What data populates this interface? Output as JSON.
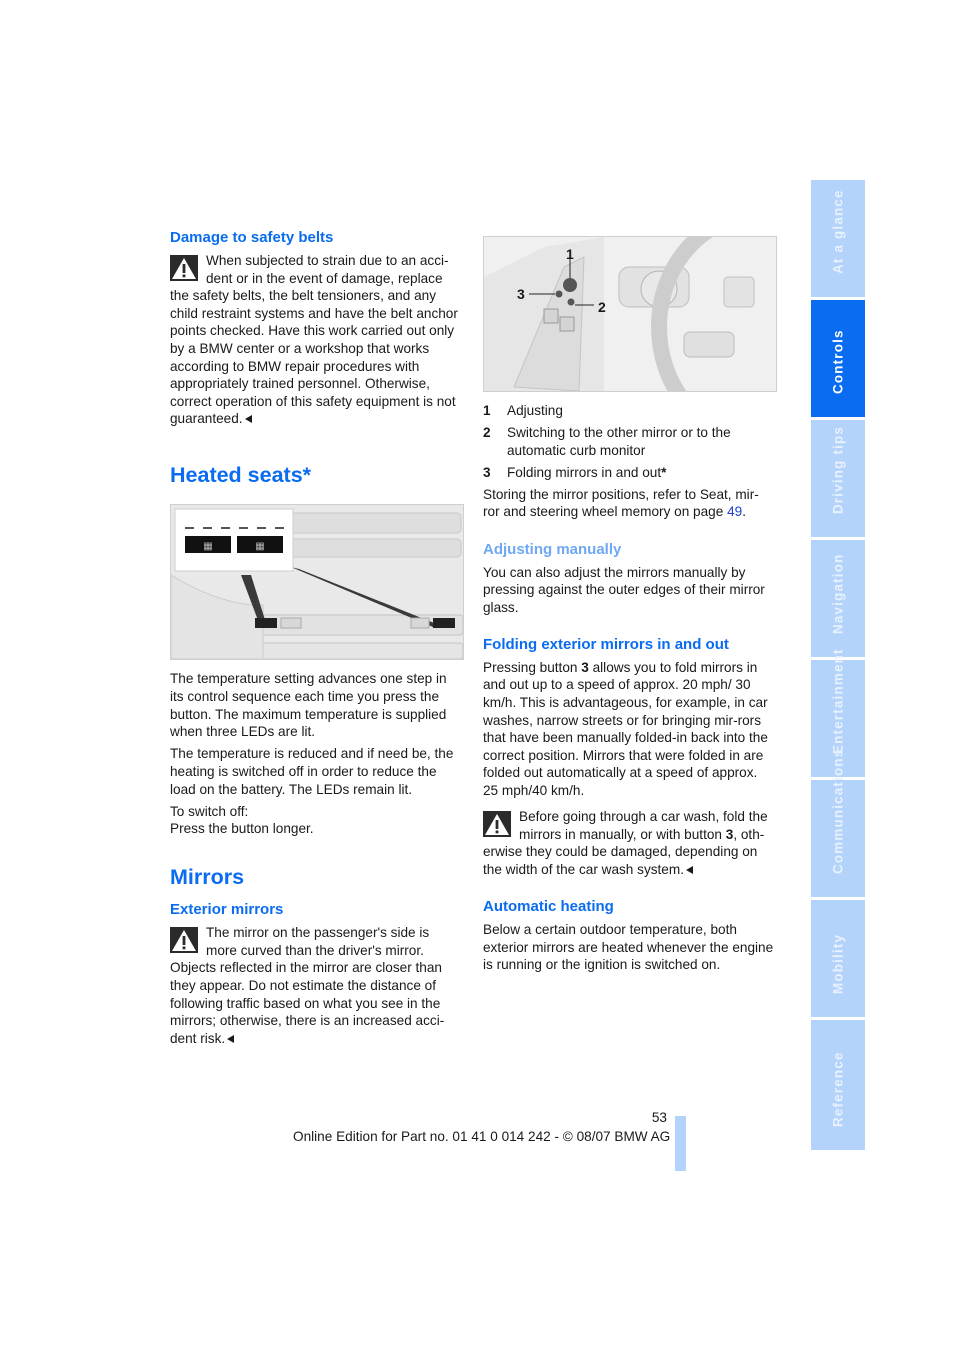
{
  "left_column": {
    "damage_heading": "Damage to safety belts",
    "damage_warning": "When subjected to strain due to an acci-dent or in the event of damage, replace the safety belts, the belt tensioners, and any child restraint systems and have the belt anchor points checked. Have this work carried out only by a BMW center or a workshop that works according to BMW repair procedures with appropriately trained personnel. Otherwise, correct operation of this safety equipment is not guaranteed.",
    "heated_seats_title": "Heated seats*",
    "heated_para1": "The temperature setting advances one step in its control sequence each time you press the button. The maximum temperature is supplied when three LEDs are lit.",
    "heated_para2": "The temperature is reduced and if need be, the heating is switched off in order to reduce the load on the battery. The LEDs remain lit.",
    "switch_off_label": "To switch off:",
    "switch_off_text": "Press the button longer.",
    "mirrors_title": "Mirrors",
    "exterior_heading": "Exterior mirrors",
    "exterior_warning": "The mirror on the passenger's side is more curved than the driver's mirror. Objects reflected in the mirror are closer than they appear. Do not estimate the distance of following traffic based on what you see in the mirrors; otherwise, there is an increased acci-dent risk."
  },
  "right_column": {
    "figure_callouts": [
      "1",
      "2",
      "3"
    ],
    "legend": [
      {
        "num": "1",
        "text": "Adjusting"
      },
      {
        "num": "2",
        "text": "Switching to the other mirror or to the automatic curb monitor"
      },
      {
        "num": "3",
        "text": "Folding mirrors in and out",
        "asterisk": "*"
      }
    ],
    "storing_text": "Storing the mirror positions, refer to Seat, mir-ror and steering wheel memory on page ",
    "storing_page_link": "49",
    "storing_end": ".",
    "adjusting_heading": "Adjusting manually",
    "adjusting_text": "You can also adjust the mirrors manually by pressing against the outer edges of their mirror glass.",
    "folding_heading": "Folding exterior mirrors in and out",
    "folding_text_pre": "Pressing button ",
    "folding_button": "3",
    "folding_text_post": " allows you to fold mirrors in and out up to a speed of approx. 20 mph/ 30 km/h. This is advantageous, for example, in car washes, narrow streets or for bringing mir-rors that have been manually folded-in back into the correct position. Mirrors that were folded in are folded out automatically at a speed of approx. 25 mph/40 km/h.",
    "carwash_warning_pre": "Before going through a car wash, fold the mirrors in manually, or with button ",
    "carwash_button": "3",
    "carwash_warning_post": ", oth-erwise they could be damaged, depending on the width of the car wash system.",
    "heating_heading": "Automatic heating",
    "heating_text": "Below a certain outdoor temperature, both exterior mirrors are heated whenever the engine is running or the ignition is switched on."
  },
  "side_tabs": [
    {
      "label": "At a glance",
      "active": false
    },
    {
      "label": "Controls",
      "active": true
    },
    {
      "label": "Driving tips",
      "active": false
    },
    {
      "label": "Navigation",
      "active": false
    },
    {
      "label": "Entertainment",
      "active": false
    },
    {
      "label": "Communications",
      "active": false
    },
    {
      "label": "Mobility",
      "active": false
    },
    {
      "label": "Reference",
      "active": false
    }
  ],
  "footer": {
    "page_number": "53",
    "edition_text": "Online Edition for Part no. 01 41 0 014 242 - © 08/07 BMW AG"
  },
  "colors": {
    "heading_blue": "#0a6cf0",
    "light_heading_blue": "#6ea8f5",
    "tab_inactive": "#b3d3fb",
    "tab_active": "#0a6cf0"
  }
}
